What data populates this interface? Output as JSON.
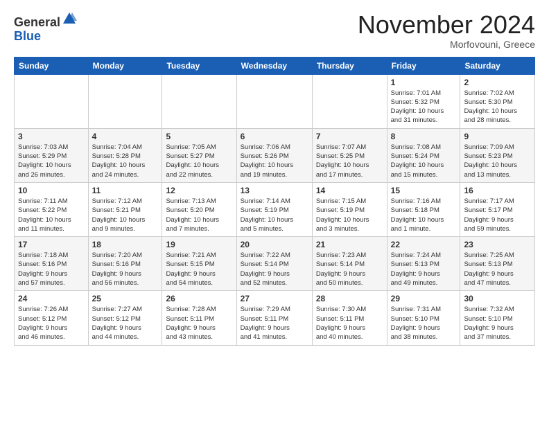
{
  "header": {
    "logo_general": "General",
    "logo_blue": "Blue",
    "month_title": "November 2024",
    "subtitle": "Morfovouni, Greece"
  },
  "days_of_week": [
    "Sunday",
    "Monday",
    "Tuesday",
    "Wednesday",
    "Thursday",
    "Friday",
    "Saturday"
  ],
  "weeks": [
    [
      {
        "day": "",
        "info": ""
      },
      {
        "day": "",
        "info": ""
      },
      {
        "day": "",
        "info": ""
      },
      {
        "day": "",
        "info": ""
      },
      {
        "day": "",
        "info": ""
      },
      {
        "day": "1",
        "info": "Sunrise: 7:01 AM\nSunset: 5:32 PM\nDaylight: 10 hours\nand 31 minutes."
      },
      {
        "day": "2",
        "info": "Sunrise: 7:02 AM\nSunset: 5:30 PM\nDaylight: 10 hours\nand 28 minutes."
      }
    ],
    [
      {
        "day": "3",
        "info": "Sunrise: 7:03 AM\nSunset: 5:29 PM\nDaylight: 10 hours\nand 26 minutes."
      },
      {
        "day": "4",
        "info": "Sunrise: 7:04 AM\nSunset: 5:28 PM\nDaylight: 10 hours\nand 24 minutes."
      },
      {
        "day": "5",
        "info": "Sunrise: 7:05 AM\nSunset: 5:27 PM\nDaylight: 10 hours\nand 22 minutes."
      },
      {
        "day": "6",
        "info": "Sunrise: 7:06 AM\nSunset: 5:26 PM\nDaylight: 10 hours\nand 19 minutes."
      },
      {
        "day": "7",
        "info": "Sunrise: 7:07 AM\nSunset: 5:25 PM\nDaylight: 10 hours\nand 17 minutes."
      },
      {
        "day": "8",
        "info": "Sunrise: 7:08 AM\nSunset: 5:24 PM\nDaylight: 10 hours\nand 15 minutes."
      },
      {
        "day": "9",
        "info": "Sunrise: 7:09 AM\nSunset: 5:23 PM\nDaylight: 10 hours\nand 13 minutes."
      }
    ],
    [
      {
        "day": "10",
        "info": "Sunrise: 7:11 AM\nSunset: 5:22 PM\nDaylight: 10 hours\nand 11 minutes."
      },
      {
        "day": "11",
        "info": "Sunrise: 7:12 AM\nSunset: 5:21 PM\nDaylight: 10 hours\nand 9 minutes."
      },
      {
        "day": "12",
        "info": "Sunrise: 7:13 AM\nSunset: 5:20 PM\nDaylight: 10 hours\nand 7 minutes."
      },
      {
        "day": "13",
        "info": "Sunrise: 7:14 AM\nSunset: 5:19 PM\nDaylight: 10 hours\nand 5 minutes."
      },
      {
        "day": "14",
        "info": "Sunrise: 7:15 AM\nSunset: 5:19 PM\nDaylight: 10 hours\nand 3 minutes."
      },
      {
        "day": "15",
        "info": "Sunrise: 7:16 AM\nSunset: 5:18 PM\nDaylight: 10 hours\nand 1 minute."
      },
      {
        "day": "16",
        "info": "Sunrise: 7:17 AM\nSunset: 5:17 PM\nDaylight: 9 hours\nand 59 minutes."
      }
    ],
    [
      {
        "day": "17",
        "info": "Sunrise: 7:18 AM\nSunset: 5:16 PM\nDaylight: 9 hours\nand 57 minutes."
      },
      {
        "day": "18",
        "info": "Sunrise: 7:20 AM\nSunset: 5:16 PM\nDaylight: 9 hours\nand 56 minutes."
      },
      {
        "day": "19",
        "info": "Sunrise: 7:21 AM\nSunset: 5:15 PM\nDaylight: 9 hours\nand 54 minutes."
      },
      {
        "day": "20",
        "info": "Sunrise: 7:22 AM\nSunset: 5:14 PM\nDaylight: 9 hours\nand 52 minutes."
      },
      {
        "day": "21",
        "info": "Sunrise: 7:23 AM\nSunset: 5:14 PM\nDaylight: 9 hours\nand 50 minutes."
      },
      {
        "day": "22",
        "info": "Sunrise: 7:24 AM\nSunset: 5:13 PM\nDaylight: 9 hours\nand 49 minutes."
      },
      {
        "day": "23",
        "info": "Sunrise: 7:25 AM\nSunset: 5:13 PM\nDaylight: 9 hours\nand 47 minutes."
      }
    ],
    [
      {
        "day": "24",
        "info": "Sunrise: 7:26 AM\nSunset: 5:12 PM\nDaylight: 9 hours\nand 46 minutes."
      },
      {
        "day": "25",
        "info": "Sunrise: 7:27 AM\nSunset: 5:12 PM\nDaylight: 9 hours\nand 44 minutes."
      },
      {
        "day": "26",
        "info": "Sunrise: 7:28 AM\nSunset: 5:11 PM\nDaylight: 9 hours\nand 43 minutes."
      },
      {
        "day": "27",
        "info": "Sunrise: 7:29 AM\nSunset: 5:11 PM\nDaylight: 9 hours\nand 41 minutes."
      },
      {
        "day": "28",
        "info": "Sunrise: 7:30 AM\nSunset: 5:11 PM\nDaylight: 9 hours\nand 40 minutes."
      },
      {
        "day": "29",
        "info": "Sunrise: 7:31 AM\nSunset: 5:10 PM\nDaylight: 9 hours\nand 38 minutes."
      },
      {
        "day": "30",
        "info": "Sunrise: 7:32 AM\nSunset: 5:10 PM\nDaylight: 9 hours\nand 37 minutes."
      }
    ]
  ]
}
